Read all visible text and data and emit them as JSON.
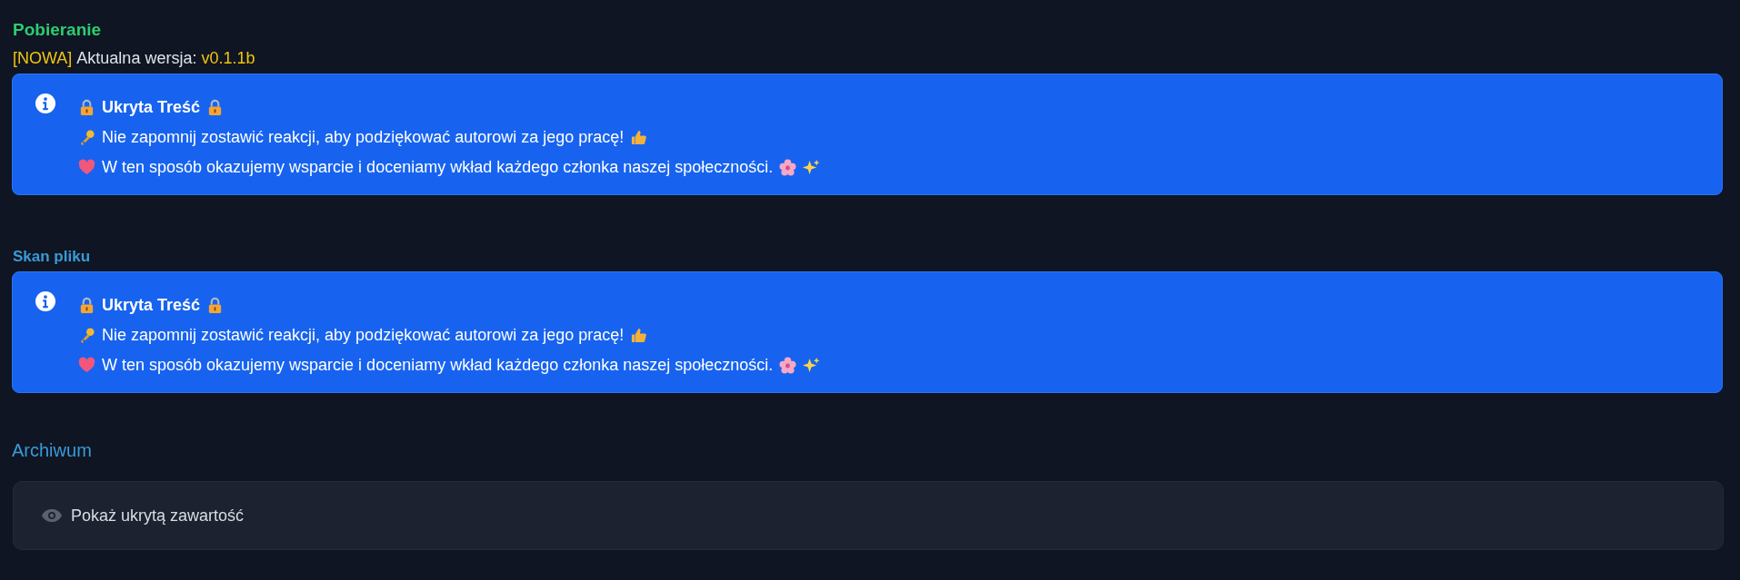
{
  "download": {
    "title": "Pobieranie",
    "badge": "[NOWA]",
    "version_label": "Aktualna wersja:",
    "version": "v0.1.1b",
    "notice": {
      "title": "Ukryta Treść",
      "lines": [
        "Nie zapomnij zostawić reakcji, aby podziękować autorowi za jego pracę!",
        "W ten sposób okazujemy wsparcie i doceniamy wkład każdego członka naszej społeczności."
      ]
    }
  },
  "scan": {
    "title": "Skan pliku",
    "notice": {
      "title": "Ukryta Treść",
      "lines": [
        "Nie zapomnij zostawić reakcji, aby podziękować autorowi za jego pracę!",
        "W ten sposób okazujemy wsparcie i doceniamy wkład każdego członka naszej społeczności."
      ]
    }
  },
  "archive": {
    "title": "Archiwum",
    "reveal": "Pokaż ukrytą zawartość"
  }
}
